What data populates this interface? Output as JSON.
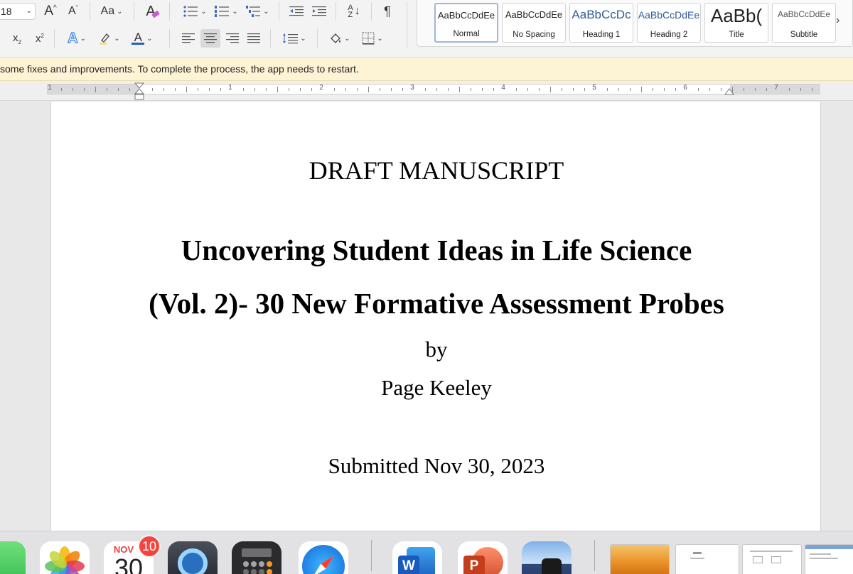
{
  "ribbon": {
    "font_size": "18",
    "styles": [
      {
        "sample": "AaBbCcDdEe",
        "name": "Normal"
      },
      {
        "sample": "AaBbCcDdEe",
        "name": "No Spacing"
      },
      {
        "sample": "AaBbCcDc",
        "name": "Heading 1"
      },
      {
        "sample": "AaBbCcDdEe",
        "name": "Heading 2"
      },
      {
        "sample": "AaBb(",
        "name": "Title"
      },
      {
        "sample": "AaBbCcDdEe",
        "name": "Subtitle"
      }
    ],
    "icons": {
      "grow_font": "A",
      "shrink_font": "A",
      "change_case": "Aa",
      "text_effects": "A",
      "font_color": "A",
      "subscript": "x",
      "subscript_mark": "2",
      "superscript": "x",
      "superscript_mark": "2",
      "sort": "A",
      "sort_z": "Z",
      "pilcrow": "¶"
    },
    "colors": {
      "font_color": "#2a5dbf",
      "highlight": "#f6e23c",
      "text_effect": "#3d7ee0"
    }
  },
  "message_bar": {
    "text": "some fixes and improvements. To complete the process, the app needs to restart."
  },
  "ruler": {
    "numbers": [
      "1",
      "1",
      "2",
      "3",
      "4",
      "5",
      "6",
      "7"
    ]
  },
  "document": {
    "line1": "DRAFT MANUSCRIPT",
    "line2": "Uncovering Student Ideas in Life Science",
    "line3": "(Vol. 2)- 30 New Formative Assessment Probes",
    "line4": "by",
    "line5": "Page Keeley",
    "line6": "Submitted Nov 30, 2023"
  },
  "dock": {
    "calendar_month": "NOV",
    "calendar_day": "30",
    "calendar_badge": "10",
    "word_letter": "W",
    "powerpoint_letter": "P"
  }
}
